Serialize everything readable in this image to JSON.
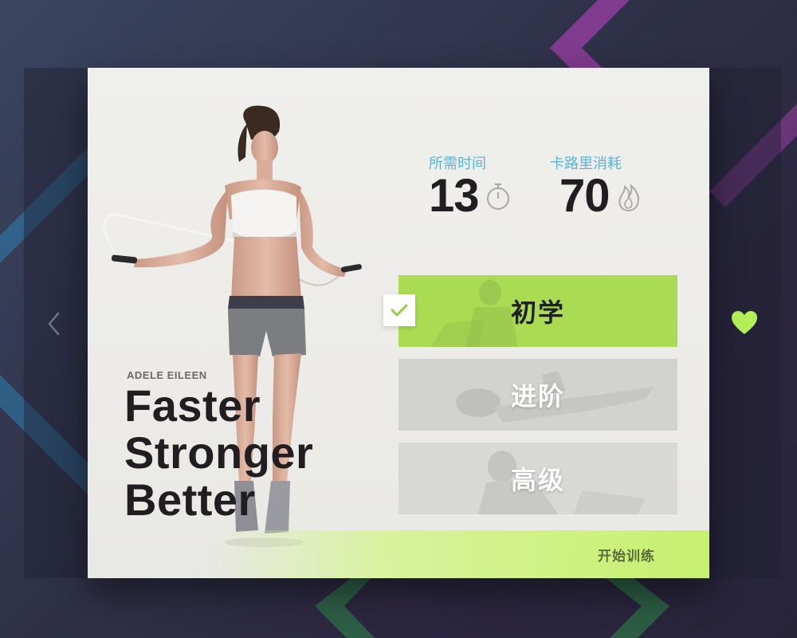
{
  "card": {
    "author": "ADELE EILEEN",
    "slogan": [
      "Faster",
      "Stronger",
      "Better"
    ]
  },
  "stats": [
    {
      "label": "所需时间",
      "value": "13",
      "icon": "stopwatch-icon"
    },
    {
      "label": "卡路里消耗",
      "value": "70",
      "icon": "flame-icon"
    }
  ],
  "levels": [
    {
      "label": "初学",
      "selected": true
    },
    {
      "label": "进阶",
      "selected": false
    },
    {
      "label": "高级",
      "selected": false
    }
  ],
  "start_button": "开始训练",
  "nav": {
    "prev_icon": "chevron-left-icon",
    "favorite_icon": "heart-icon"
  },
  "colors": {
    "accent_green": "#a9dc52",
    "heart_green": "#b4f05a",
    "label_blue": "#5ab5dc",
    "title_dark": "#221d21"
  }
}
